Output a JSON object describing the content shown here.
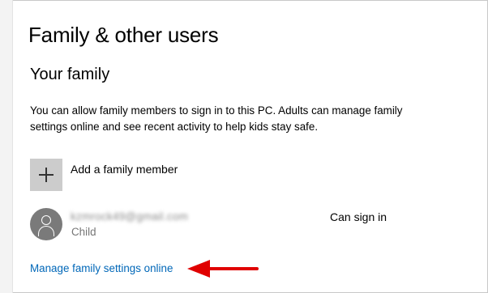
{
  "page": {
    "title": "Family & other users"
  },
  "family": {
    "section_title": "Your family",
    "description": "You can allow family members to sign in to this PC. Adults can manage family settings online and see recent activity to help kids stay safe.",
    "add_member_label": "Add a family member",
    "members": [
      {
        "email": "kzmrock49@gmail.com",
        "role": "Child",
        "status": "Can sign in"
      }
    ],
    "manage_link": "Manage family settings online"
  },
  "annotation": {
    "arrow_color": "#e00000"
  },
  "colors": {
    "link": "#0067b8",
    "tile": "#cccccc",
    "avatar": "#7a7a7a"
  }
}
